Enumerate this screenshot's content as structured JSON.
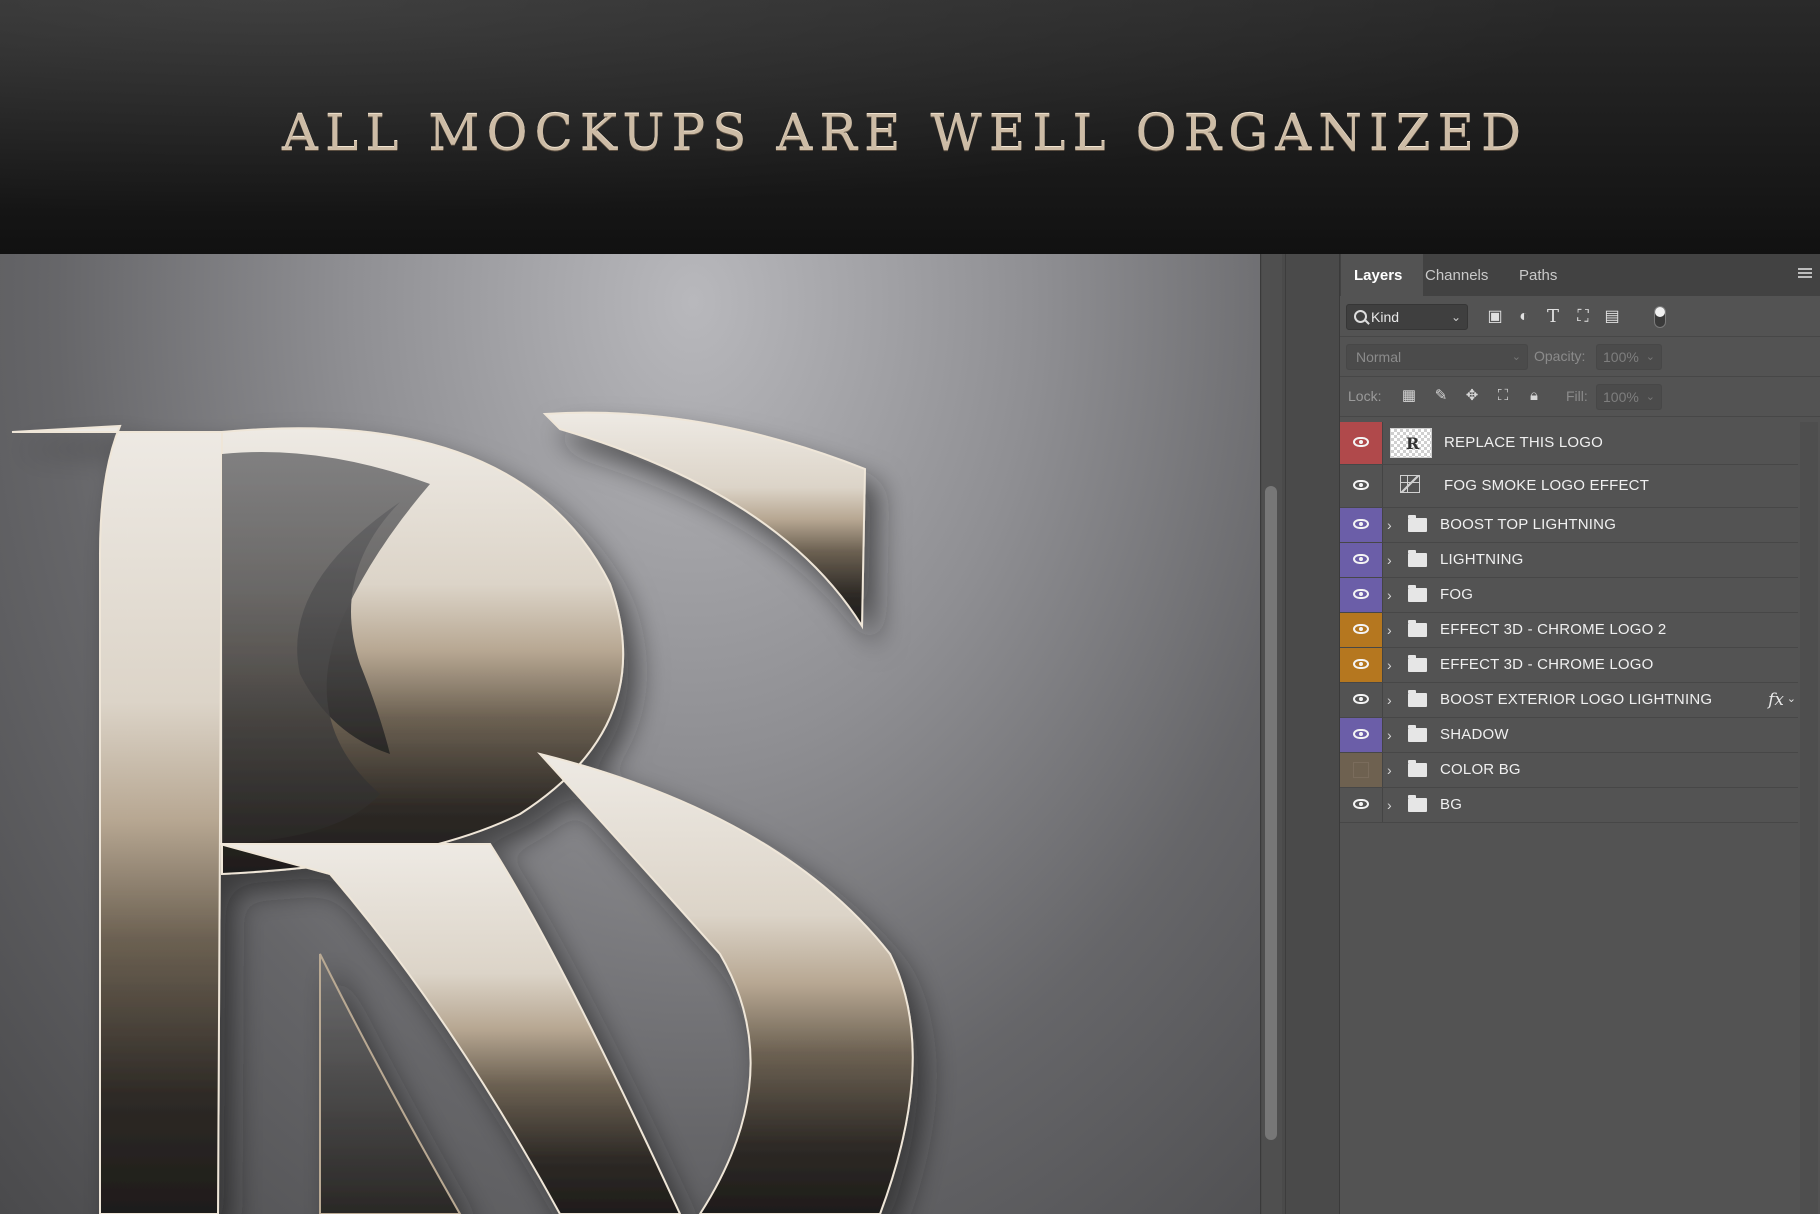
{
  "banner": {
    "title": "ALL MOCKUPS ARE WELL ORGANIZED"
  },
  "panel": {
    "tabs": [
      {
        "label": "Layers",
        "active": true
      },
      {
        "label": "Channels",
        "active": false
      },
      {
        "label": "Paths",
        "active": false
      }
    ],
    "filter": {
      "kind_label": "Kind"
    },
    "blend": {
      "mode": "Normal",
      "opacity_label": "Opacity:",
      "opacity_value": "100%",
      "fill_label": "Fill:",
      "fill_value": "100%"
    },
    "lock": {
      "label": "Lock:"
    },
    "layers": [
      {
        "name": "REPLACE THIS LOGO",
        "kind": "smart-object",
        "visible": true,
        "color": "#b0494b"
      },
      {
        "name": "FOG SMOKE LOGO EFFECT",
        "kind": "adjustment",
        "visible": true,
        "color": "#535353"
      },
      {
        "name": "BOOST TOP LIGHTNING",
        "kind": "group",
        "visible": true,
        "color": "#6b5ea8"
      },
      {
        "name": "LIGHTNING",
        "kind": "group",
        "visible": true,
        "color": "#6b5ea8"
      },
      {
        "name": "FOG",
        "kind": "group",
        "visible": true,
        "color": "#6b5ea8"
      },
      {
        "name": "EFFECT 3D - CHROME LOGO 2",
        "kind": "group",
        "visible": true,
        "color": "#b5771f"
      },
      {
        "name": "EFFECT 3D - CHROME LOGO",
        "kind": "group",
        "visible": true,
        "color": "#b5771f"
      },
      {
        "name": "BOOST EXTERIOR LOGO LIGHTNING",
        "kind": "group",
        "visible": true,
        "color": "#535353",
        "fx": "fx"
      },
      {
        "name": "SHADOW",
        "kind": "group",
        "visible": true,
        "color": "#6b5ea8"
      },
      {
        "name": "COLOR BG",
        "kind": "group",
        "visible": false,
        "color": "#6e6150"
      },
      {
        "name": "BG",
        "kind": "group",
        "visible": true,
        "color": "#535353"
      }
    ]
  }
}
